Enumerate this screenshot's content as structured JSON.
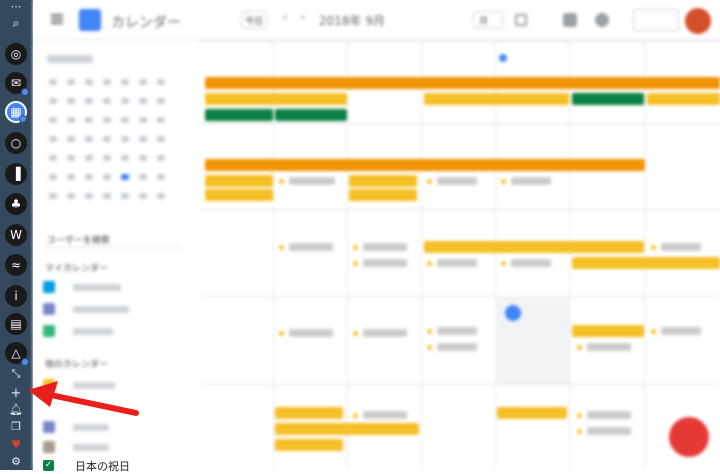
{
  "app": {
    "title": "カレンダー",
    "header_date": "2018年 9月",
    "today_label": "今日",
    "view_label": "月"
  },
  "sidebar": {
    "search_label": "ユーザーを検索",
    "my_calendars_title": "マイカレンダー",
    "other_calendars_title": "他のカレンダー",
    "holiday_calendar_label": "日本の祝日"
  },
  "colors": {
    "dock_bg": "#34495e",
    "accent_red": "#e53935",
    "event_orange": "#f09300",
    "event_yellow": "#f6bf26",
    "event_green": "#0b8043",
    "today_blue": "#4285f4"
  },
  "dock_items": [
    "search-icon",
    "chrome-icon",
    "gmail-icon",
    "calendar-icon",
    "github-icon",
    "trello-icon",
    "evernote-icon",
    "wordpress-icon",
    "server-icon",
    "info-icon",
    "docs-icon",
    "drive-icon"
  ]
}
